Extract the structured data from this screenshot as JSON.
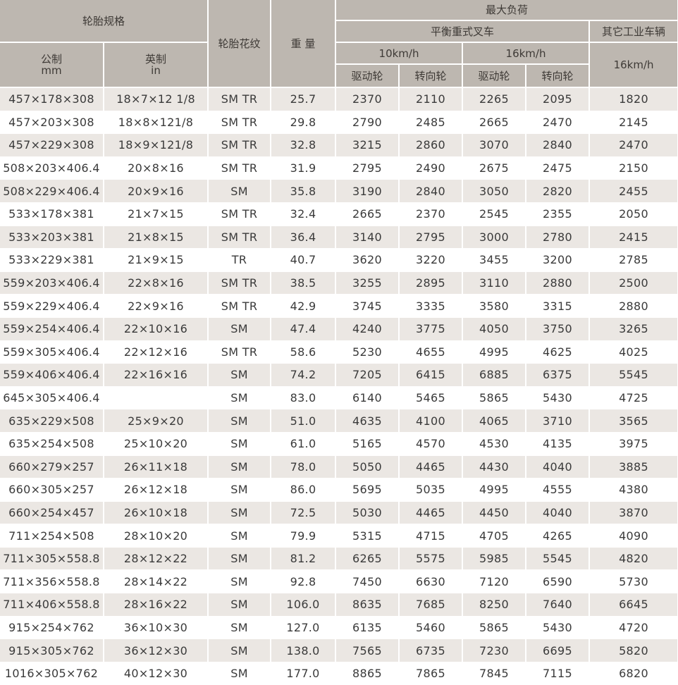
{
  "header": {
    "spec": "轮胎规格",
    "tread": "轮胎花纹",
    "weight": "重 量",
    "max_load": "最大负荷",
    "forklift": "平衡重式叉车",
    "other_vehicle": "其它工业车辆",
    "metric_label": "公制",
    "metric_unit": "mm",
    "imperial_label": "英制",
    "imperial_unit": "in",
    "speed_10": "10km/h",
    "speed_16": "16km/h",
    "speed_16_other": "16km/h",
    "drive_wheel_10": "驱动轮",
    "steer_wheel_10": "转向轮",
    "drive_wheel_16": "驱动轮",
    "steer_wheel_16": "转向轮"
  },
  "rows": [
    {
      "metric": "457×178×308",
      "imperial": "18×7×12 1/8",
      "tread": "SM TR",
      "weight": "25.7",
      "d10": "2370",
      "s10": "2110",
      "d16": "2265",
      "s16": "2095",
      "other": "1820"
    },
    {
      "metric": "457×203×308",
      "imperial": "18×8×121/8",
      "tread": "SM TR",
      "weight": "29.8",
      "d10": "2790",
      "s10": "2485",
      "d16": "2665",
      "s16": "2470",
      "other": "2145"
    },
    {
      "metric": "457×229×308",
      "imperial": "18×9×121/8",
      "tread": "SM TR",
      "weight": "32.8",
      "d10": "3215",
      "s10": "2860",
      "d16": "3070",
      "s16": "2840",
      "other": "2470"
    },
    {
      "metric": "508×203×406.4",
      "imperial": "20×8×16",
      "tread": "SM TR",
      "weight": "31.9",
      "d10": "2795",
      "s10": "2490",
      "d16": "2675",
      "s16": "2475",
      "other": "2150"
    },
    {
      "metric": "508×229×406.4",
      "imperial": "20×9×16",
      "tread": "SM",
      "weight": "35.8",
      "d10": "3190",
      "s10": "2840",
      "d16": "3050",
      "s16": "2820",
      "other": "2455"
    },
    {
      "metric": "533×178×381",
      "imperial": "21×7×15",
      "tread": "SM TR",
      "weight": "32.4",
      "d10": "2665",
      "s10": "2370",
      "d16": "2545",
      "s16": "2355",
      "other": "2050"
    },
    {
      "metric": "533×203×381",
      "imperial": "21×8×15",
      "tread": "SM TR",
      "weight": "36.4",
      "d10": "3140",
      "s10": "2795",
      "d16": "3000",
      "s16": "2780",
      "other": "2415"
    },
    {
      "metric": "533×229×381",
      "imperial": "21×9×15",
      "tread": "TR",
      "weight": "40.7",
      "d10": "3620",
      "s10": "3220",
      "d16": "3455",
      "s16": "3200",
      "other": "2785"
    },
    {
      "metric": "559×203×406.4",
      "imperial": "22×8×16",
      "tread": "SM TR",
      "weight": "38.5",
      "d10": "3255",
      "s10": "2895",
      "d16": "3110",
      "s16": "2880",
      "other": "2500"
    },
    {
      "metric": "559×229×406.4",
      "imperial": "22×9×16",
      "tread": "SM TR",
      "weight": "42.9",
      "d10": "3745",
      "s10": "3335",
      "d16": "3580",
      "s16": "3315",
      "other": "2880"
    },
    {
      "metric": "559×254×406.4",
      "imperial": "22×10×16",
      "tread": "SM",
      "weight": "47.4",
      "d10": "4240",
      "s10": "3775",
      "d16": "4050",
      "s16": "3750",
      "other": "3265"
    },
    {
      "metric": "559×305×406.4",
      "imperial": "22×12×16",
      "tread": "SM TR",
      "weight": "58.6",
      "d10": "5230",
      "s10": "4655",
      "d16": "4995",
      "s16": "4625",
      "other": "4025"
    },
    {
      "metric": "559×406×406.4",
      "imperial": "22×16×16",
      "tread": "SM",
      "weight": "74.2",
      "d10": "7205",
      "s10": "6415",
      "d16": "6885",
      "s16": "6375",
      "other": "5545"
    },
    {
      "metric": "645×305×406.4",
      "imperial": "",
      "tread": "SM",
      "weight": "83.0",
      "d10": "6140",
      "s10": "5465",
      "d16": "5865",
      "s16": "5430",
      "other": "4725"
    },
    {
      "metric": "635×229×508",
      "imperial": "25×9×20",
      "tread": "SM",
      "weight": "51.0",
      "d10": "4635",
      "s10": "4100",
      "d16": "4065",
      "s16": "3710",
      "other": "3565"
    },
    {
      "metric": "635×254×508",
      "imperial": "25×10×20",
      "tread": "SM",
      "weight": "61.0",
      "d10": "5165",
      "s10": "4570",
      "d16": "4530",
      "s16": "4135",
      "other": "3975"
    },
    {
      "metric": "660×279×257",
      "imperial": "26×11×18",
      "tread": "SM",
      "weight": "78.0",
      "d10": "5050",
      "s10": "4465",
      "d16": "4430",
      "s16": "4040",
      "other": "3885"
    },
    {
      "metric": "660×305×257",
      "imperial": "26×12×18",
      "tread": "SM",
      "weight": "86.0",
      "d10": "5695",
      "s10": "5035",
      "d16": "4995",
      "s16": "4555",
      "other": "4380"
    },
    {
      "metric": "660×254×457",
      "imperial": "26×10×18",
      "tread": "SM",
      "weight": "72.5",
      "d10": "5030",
      "s10": "4465",
      "d16": "4450",
      "s16": "4040",
      "other": "3870"
    },
    {
      "metric": "711×254×508",
      "imperial": "28×10×20",
      "tread": "SM",
      "weight": "79.9",
      "d10": "5315",
      "s10": "4715",
      "d16": "4705",
      "s16": "4265",
      "other": "4090"
    },
    {
      "metric": "711×305×558.8",
      "imperial": "28×12×22",
      "tread": "SM",
      "weight": "81.2",
      "d10": "6265",
      "s10": "5575",
      "d16": "5985",
      "s16": "5545",
      "other": "4820"
    },
    {
      "metric": "711×356×558.8",
      "imperial": "28×14×22",
      "tread": "SM",
      "weight": "92.8",
      "d10": "7450",
      "s10": "6630",
      "d16": "7120",
      "s16": "6590",
      "other": "5730"
    },
    {
      "metric": "711×406×558.8",
      "imperial": "28×16×22",
      "tread": "SM",
      "weight": "106.0",
      "d10": "8635",
      "s10": "7685",
      "d16": "8250",
      "s16": "7640",
      "other": "6645"
    },
    {
      "metric": "915×254×762",
      "imperial": "36×10×30",
      "tread": "SM",
      "weight": "127.0",
      "d10": "6135",
      "s10": "5460",
      "d16": "5865",
      "s16": "5430",
      "other": "4720"
    },
    {
      "metric": "915×305×762",
      "imperial": "36×12×30",
      "tread": "SM",
      "weight": "138.0",
      "d10": "7565",
      "s10": "6735",
      "d16": "7230",
      "s16": "6695",
      "other": "5820"
    },
    {
      "metric": "1016×305×762",
      "imperial": "40×12×30",
      "tread": "SM",
      "weight": "177.0",
      "d10": "8865",
      "s10": "7865",
      "d16": "7845",
      "s16": "7115",
      "other": "6820"
    }
  ]
}
